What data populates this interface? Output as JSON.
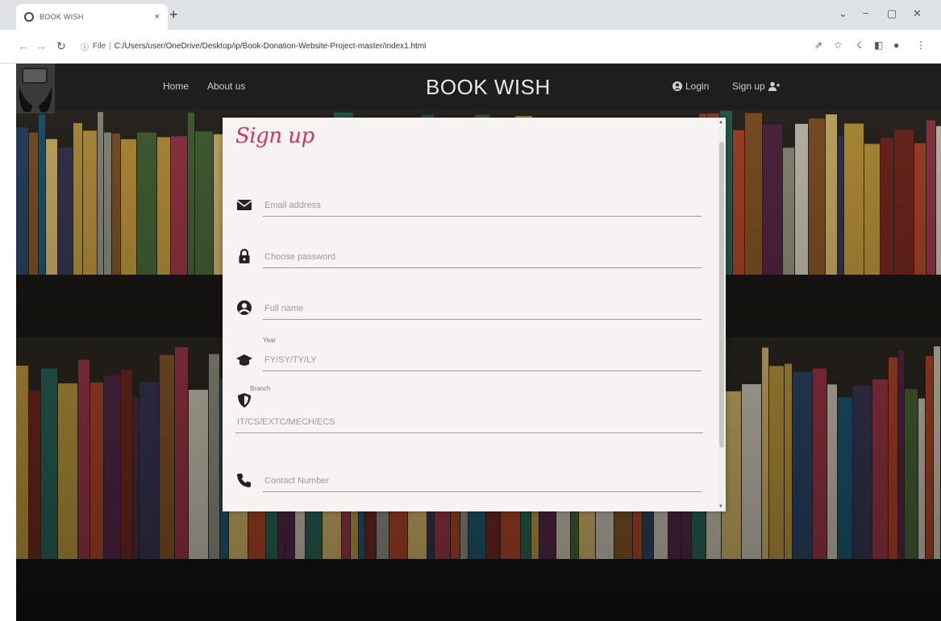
{
  "browser": {
    "tab_title": "BOOK WISH",
    "tab_close": "×",
    "new_tab": "+",
    "url_file_label": "File",
    "url": "C:/Users/user/OneDrive/Desktop/ip/Book-Donation-Website-Project-master/index1.html",
    "window_controls": [
      "⌄",
      "−",
      "▢",
      "✕"
    ]
  },
  "navbar": {
    "home": "Home",
    "about": "About us",
    "brand": "BOOK WISH",
    "login": "Login",
    "signup": "Sign up"
  },
  "signup_form": {
    "title": "Sign up",
    "email_placeholder": "Email address",
    "password_placeholder": "Choose password",
    "fullname_placeholder": "Full name",
    "year_label": "Year",
    "year_placeholder": "FY/SY/TY/LY",
    "branch_label": "Branch",
    "branch_placeholder": "IT/CS/EXTC/MECH/ECS",
    "contact_placeholder": "Contact Number"
  },
  "colors": {
    "accent": "#d2335d",
    "navbar_bg": "#1e1e1e",
    "modal_bg": "#f7f3f3"
  },
  "icons": [
    "globe-icon",
    "back-icon",
    "forward-icon",
    "reload-icon",
    "info-icon",
    "share-icon",
    "star-icon",
    "extension-icon",
    "sidepanel-icon",
    "profile-icon",
    "menu-icon",
    "user-circle-icon",
    "user-plus-icon",
    "envelope-icon",
    "lock-icon",
    "graduation-cap-icon",
    "shield-icon",
    "phone-icon"
  ]
}
